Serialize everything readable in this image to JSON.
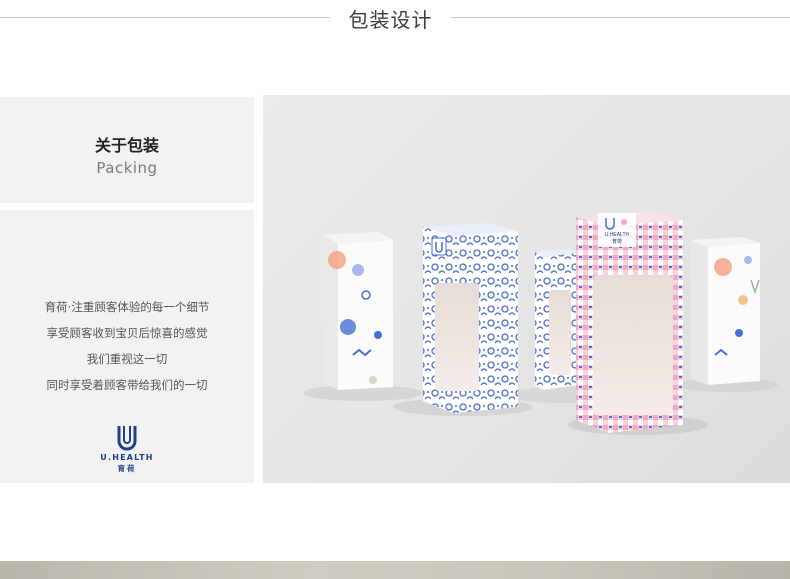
{
  "header": {
    "title": "包装设计"
  },
  "about": {
    "title": "关于包装",
    "subtitle": "Packing"
  },
  "description": {
    "lines": [
      "育荷·注重顾客体验的每一个细节",
      "享受顾客收到宝贝后惊喜的感觉",
      "我们重视这一切",
      "同时享受着顾客带给我们的一切"
    ]
  },
  "logo": {
    "brand": "U.HEALTH",
    "brand_cn": "育荷"
  },
  "product_image": {
    "box_labels": [
      "U.HEALTH",
      "育荷"
    ]
  },
  "colors": {
    "panel_bg": "#f2f2f2",
    "brand_blue": "#1f3f8a",
    "pattern_blue": "#4a6fd1",
    "pattern_pink": "#f2a8c0"
  }
}
